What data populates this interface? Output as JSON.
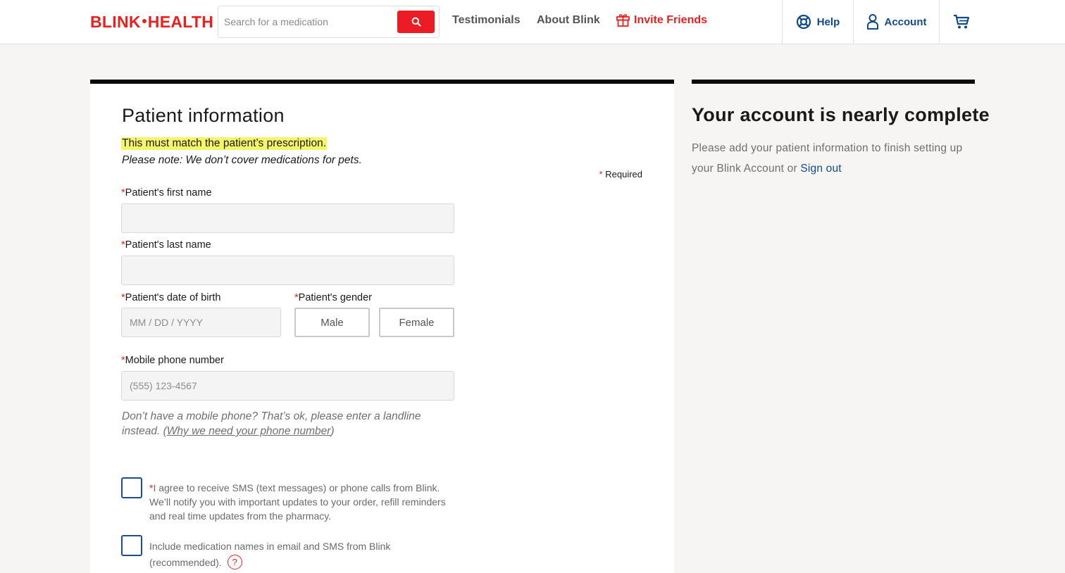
{
  "header": {
    "logo_left": "BL",
    "logo_i": "I",
    "logo_mid": "NK",
    "logo_right": "HEALTH",
    "search_placeholder": "Search for a medication",
    "nav": {
      "testimonials": "Testimonials",
      "about": "About Blink",
      "invite": "Invite Friends"
    },
    "help": "Help",
    "account": "Account"
  },
  "form": {
    "title": "Patient information",
    "highlight": "This must match the patient’s prescription.",
    "note": "Please note: We don’t cover medications for pets.",
    "required_legend": "Required",
    "first_name_label": "Patient's first name",
    "last_name_label": "Patient's last name",
    "dob_label": "Patient's date of birth",
    "dob_placeholder": "MM / DD / YYYY",
    "gender_label": "Patient's gender",
    "gender_options": [
      "Male",
      "Female"
    ],
    "phone_label": "Mobile phone number",
    "phone_placeholder": "(555) 123-4567",
    "helper_text": "Don’t have a mobile phone? That’s ok, please enter a landline instead. (",
    "helper_link": "Why we need your phone number",
    "helper_close": ")",
    "sms_consent": "I agree to receive SMS (text messages) or phone calls from Blink. We’ll notify you with important updates to your order, refill reminders and real time updates from the pharmacy.",
    "include_meds": "Include medication names in email and SMS from Blink (recommended).",
    "help_glyph": "?"
  },
  "sidebar": {
    "title": "Your account is nearly complete",
    "text": "Please add your patient information to finish setting up your Blink Account or ",
    "sign_out": "Sign out"
  },
  "colors": {
    "brand_red": "#e8211f",
    "link_blue": "#0f4a8a",
    "highlight_yellow": "#f5f56a"
  }
}
